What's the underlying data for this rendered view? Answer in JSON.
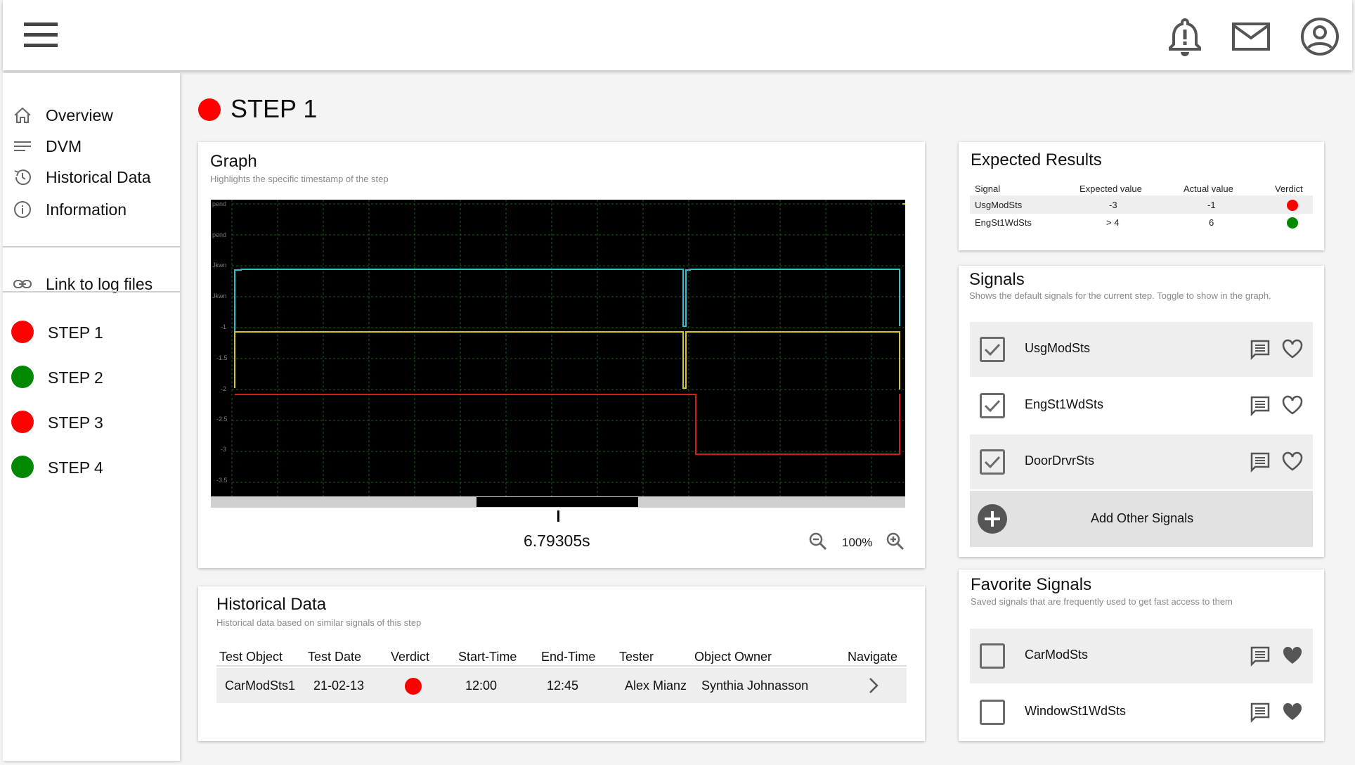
{
  "colors": {
    "fail": "#ff0000",
    "pass": "#008800",
    "graph_bg": "#000000",
    "cyan": "#2cc0d0",
    "yellow": "#d4c81e",
    "red": "#d41e1e"
  },
  "sidebar": {
    "nav": [
      {
        "label": "Overview",
        "icon": "home-icon"
      },
      {
        "label": "DVM",
        "icon": "list-icon"
      },
      {
        "label": "Historical Data",
        "icon": "history-icon"
      },
      {
        "label": "Information",
        "icon": "info-icon"
      }
    ],
    "link": {
      "label": "Link to log files",
      "icon": "link-icon"
    },
    "steps": [
      {
        "label": "STEP 1",
        "status": "fail"
      },
      {
        "label": "STEP 2",
        "status": "pass"
      },
      {
        "label": "STEP 3",
        "status": "fail"
      },
      {
        "label": "STEP 4",
        "status": "pass"
      }
    ]
  },
  "page": {
    "title": "STEP 1",
    "status": "fail"
  },
  "graph": {
    "title": "Graph",
    "subtitle": "Highlights the specific timestamp of the step",
    "y_tick_labels": [
      "pend",
      "pend",
      "Jkwn",
      "Jkwn",
      "-1",
      "-1.5",
      "-2",
      "-2.5",
      "-3",
      "-3.5"
    ],
    "timestamp": "6.79305s",
    "zoom": "100%"
  },
  "expected": {
    "title": "Expected Results",
    "headers": [
      "Signal",
      "Expected value",
      "Actual value",
      "Verdict"
    ],
    "rows": [
      {
        "signal": "UsgModSts",
        "expected": "-3",
        "actual": "-1",
        "verdict": "fail"
      },
      {
        "signal": "EngSt1WdSts",
        "expected": "> 4",
        "actual": "6",
        "verdict": "pass"
      }
    ]
  },
  "signals": {
    "title": "Signals",
    "subtitle": "Shows the default signals for the current step. Toggle to show in the graph.",
    "items": [
      {
        "label": "UsgModSts",
        "checked": true
      },
      {
        "label": "EngSt1WdSts",
        "checked": true
      },
      {
        "label": "DoorDrvrSts",
        "checked": true
      }
    ],
    "add_label": "Add Other Signals"
  },
  "favorites": {
    "title": "Favorite Signals",
    "subtitle": "Saved signals that are frequently used to get fast access to them",
    "items": [
      {
        "label": "CarModSts",
        "checked": false
      },
      {
        "label": "WindowSt1WdSts",
        "checked": false
      }
    ]
  },
  "historical": {
    "title": "Historical Data",
    "subtitle": "Historical data based on similar signals of this step",
    "headers": [
      "Test Object",
      "Test Date",
      "Verdict",
      "Start-Time",
      "End-Time",
      "Tester",
      "Object Owner",
      "Navigate"
    ],
    "rows": [
      {
        "object": "CarModSts1",
        "date": "21-02-13",
        "verdict": "fail",
        "start": "12:00",
        "end": "12:45",
        "tester": "Alex Mianz",
        "owner": "Synthia Johnasson"
      }
    ]
  }
}
